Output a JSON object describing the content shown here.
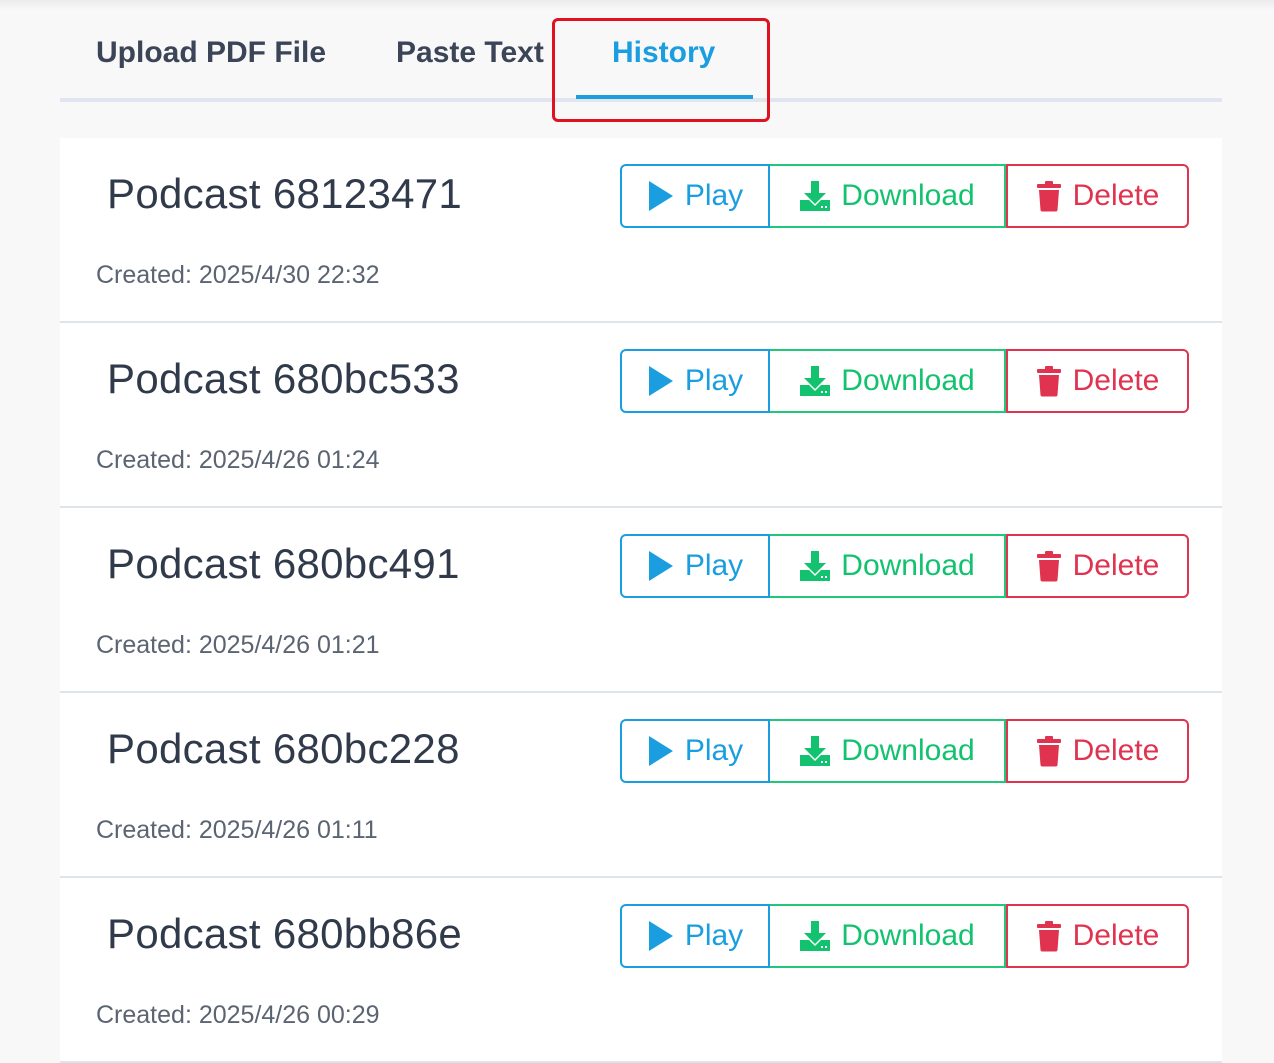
{
  "tabs": [
    {
      "label": "Upload PDF File",
      "active": false
    },
    {
      "label": "Paste Text",
      "active": false
    },
    {
      "label": "History",
      "active": true
    }
  ],
  "actions": {
    "play_label": "Play",
    "download_label": "Download",
    "delete_label": "Delete"
  },
  "history": [
    {
      "title": "Podcast 68123471",
      "created": "Created: 2025/4/30 22:32"
    },
    {
      "title": "Podcast 680bc533",
      "created": "Created: 2025/4/26 01:24"
    },
    {
      "title": "Podcast 680bc491",
      "created": "Created: 2025/4/26 01:21"
    },
    {
      "title": "Podcast 680bc228",
      "created": "Created: 2025/4/26 01:11"
    },
    {
      "title": "Podcast 680bb86e",
      "created": "Created: 2025/4/26 00:29"
    }
  ],
  "colors": {
    "accent": "#1a9ee0",
    "download": "#13c26e",
    "delete": "#e0334f",
    "highlight": "#e0121f"
  },
  "icons": {
    "play": "play-icon",
    "download": "download-icon",
    "delete": "trash-icon"
  }
}
